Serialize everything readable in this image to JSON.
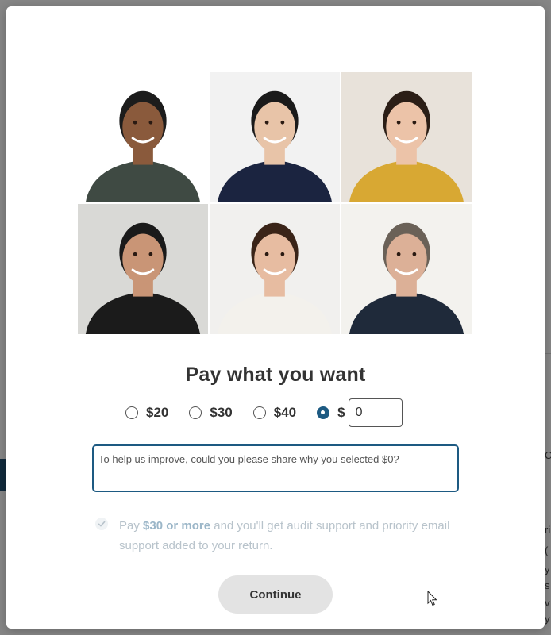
{
  "modal": {
    "title": "Pay what you want",
    "price_options": [
      {
        "label": "$20",
        "selected": false
      },
      {
        "label": "$30",
        "selected": false
      },
      {
        "label": "$40",
        "selected": false
      }
    ],
    "custom_option": {
      "prefix": "$",
      "value": "0",
      "selected": true
    },
    "reason_field": {
      "placeholder": "To help us improve, could you please share why you selected $0?"
    },
    "perk": {
      "lead": "Pay ",
      "highlight": "$30 or more",
      "rest": " and you'll get audit support and priority email support added to your return."
    },
    "continue_label": "Continue",
    "photos": [
      {
        "name": "person-1-photo",
        "bg": "#ffffff",
        "shirt": "#3f4a43",
        "skin": "#8a5a3c",
        "hair": "#1c1c1c"
      },
      {
        "name": "person-2-photo",
        "bg": "#f2f2f2",
        "shirt": "#1b2440",
        "skin": "#e8c4a8",
        "hair": "#1a1a1a"
      },
      {
        "name": "person-3-photo",
        "bg": "#e8e2da",
        "shirt": "#d8a833",
        "skin": "#ecc3a8",
        "hair": "#2b1e16"
      },
      {
        "name": "person-4-photo",
        "bg": "#d9d9d6",
        "shirt": "#1b1b1b",
        "skin": "#c99576",
        "hair": "#1a1a1a"
      },
      {
        "name": "person-5-photo",
        "bg": "#f1f0ee",
        "shirt": "#f3f1ec",
        "skin": "#e7bca1",
        "hair": "#3a2418"
      },
      {
        "name": "person-6-photo",
        "bg": "#f3f2ee",
        "shirt": "#1f2a3a",
        "skin": "#dcb097",
        "hair": "#6a6157"
      }
    ]
  },
  "colors": {
    "accent": "#1d5a82",
    "button_bg": "#e3e3e3",
    "perk_text": "#b8c3cb"
  },
  "background": {
    "right_glyphs": [
      "C",
      "ri",
      "(",
      "y",
      "s",
      "v",
      "y",
      "b"
    ]
  }
}
